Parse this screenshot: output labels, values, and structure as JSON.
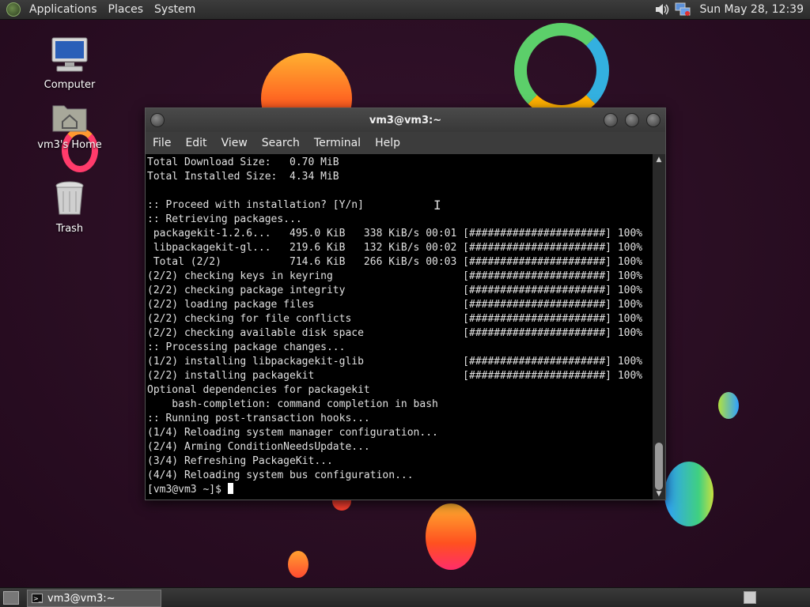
{
  "top_panel": {
    "menus": [
      "Applications",
      "Places",
      "System"
    ],
    "clock": "Sun May 28, 12:39"
  },
  "desktop_icons": [
    {
      "label": "Computer",
      "icon": "computer-icon"
    },
    {
      "label": "vm3's Home",
      "icon": "home-folder-icon"
    },
    {
      "label": "Trash",
      "icon": "trash-icon"
    }
  ],
  "window": {
    "title": "vm3@vm3:~",
    "menus": [
      "File",
      "Edit",
      "View",
      "Search",
      "Terminal",
      "Help"
    ]
  },
  "terminal": {
    "lines": [
      "Total Download Size:   0.70 MiB",
      "Total Installed Size:  4.34 MiB",
      "",
      ":: Proceed with installation? [Y/n]",
      ":: Retrieving packages...",
      " packagekit-1.2.6...   495.0 KiB   338 KiB/s 00:01 [######################] 100%",
      " libpackagekit-gl...   219.6 KiB   132 KiB/s 00:02 [######################] 100%",
      " Total (2/2)           714.6 KiB   266 KiB/s 00:03 [######################] 100%",
      "(2/2) checking keys in keyring                     [######################] 100%",
      "(2/2) checking package integrity                   [######################] 100%",
      "(2/2) loading package files                        [######################] 100%",
      "(2/2) checking for file conflicts                  [######################] 100%",
      "(2/2) checking available disk space                [######################] 100%",
      ":: Processing package changes...",
      "(1/2) installing libpackagekit-glib                [######################] 100%",
      "(2/2) installing packagekit                        [######################] 100%",
      "Optional dependencies for packagekit",
      "    bash-completion: command completion in bash",
      ":: Running post-transaction hooks...",
      "(1/4) Reloading system manager configuration...",
      "(2/4) Arming ConditionNeedsUpdate...",
      "(3/4) Refreshing PackageKit...",
      "(4/4) Reloading system bus configuration..."
    ],
    "prompt": "[vm3@vm3 ~]$ "
  },
  "taskbar": {
    "task_label": "vm3@vm3:~"
  }
}
